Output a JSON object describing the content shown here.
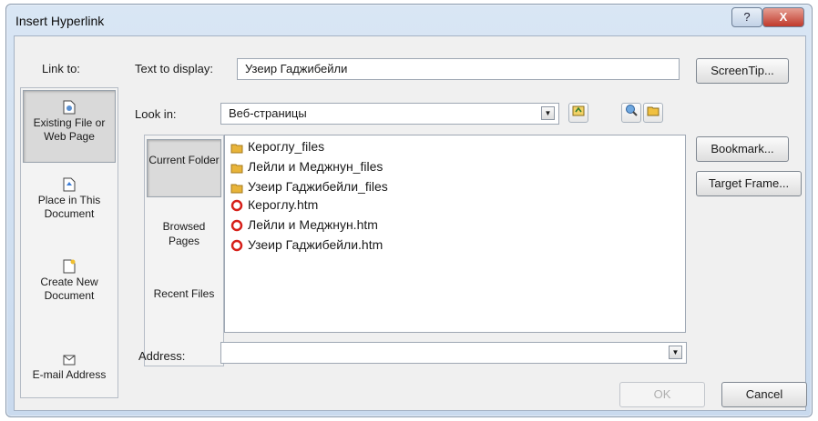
{
  "window": {
    "title": "Insert Hyperlink",
    "help_glyph": "?",
    "close_glyph": "X"
  },
  "link_to": {
    "label": "Link to:",
    "items": [
      {
        "label": "Existing File or Web Page",
        "selected": true,
        "icon": "existing-file-icon"
      },
      {
        "label": "Place in This Document",
        "selected": false,
        "icon": "place-in-document-icon"
      },
      {
        "label": "Create New Document",
        "selected": false,
        "icon": "new-document-icon"
      },
      {
        "label": "E-mail Address",
        "selected": false,
        "icon": "email-address-icon"
      }
    ]
  },
  "text_to_display": {
    "label": "Text to display:",
    "value": "Узеир Гаджибейли"
  },
  "look_in": {
    "label": "Look in:",
    "value": "Веб-страницы"
  },
  "nav": {
    "items": [
      {
        "label": "Current Folder",
        "selected": true
      },
      {
        "label": "Browsed Pages",
        "selected": false
      },
      {
        "label": "Recent Files",
        "selected": false
      }
    ]
  },
  "files": [
    {
      "name": "Кероглу_files",
      "type": "folder"
    },
    {
      "name": "Лейли и Меджнун_files",
      "type": "folder"
    },
    {
      "name": "Узеир Гаджибейли_files",
      "type": "folder"
    },
    {
      "name": "Кероглу.htm",
      "type": "htm"
    },
    {
      "name": "Лейли и Меджнун.htm",
      "type": "htm"
    },
    {
      "name": "Узеир Гаджибейли.htm",
      "type": "htm"
    }
  ],
  "address": {
    "label": "Address:",
    "value": ""
  },
  "buttons": {
    "screentip": "ScreenTip...",
    "bookmark": "Bookmark...",
    "target_frame": "Target Frame...",
    "ok": "OK",
    "cancel": "Cancel"
  },
  "colors": {
    "folder": "#e8b43a",
    "htm_ring": "#d6201a",
    "accent": "#c9daee"
  }
}
